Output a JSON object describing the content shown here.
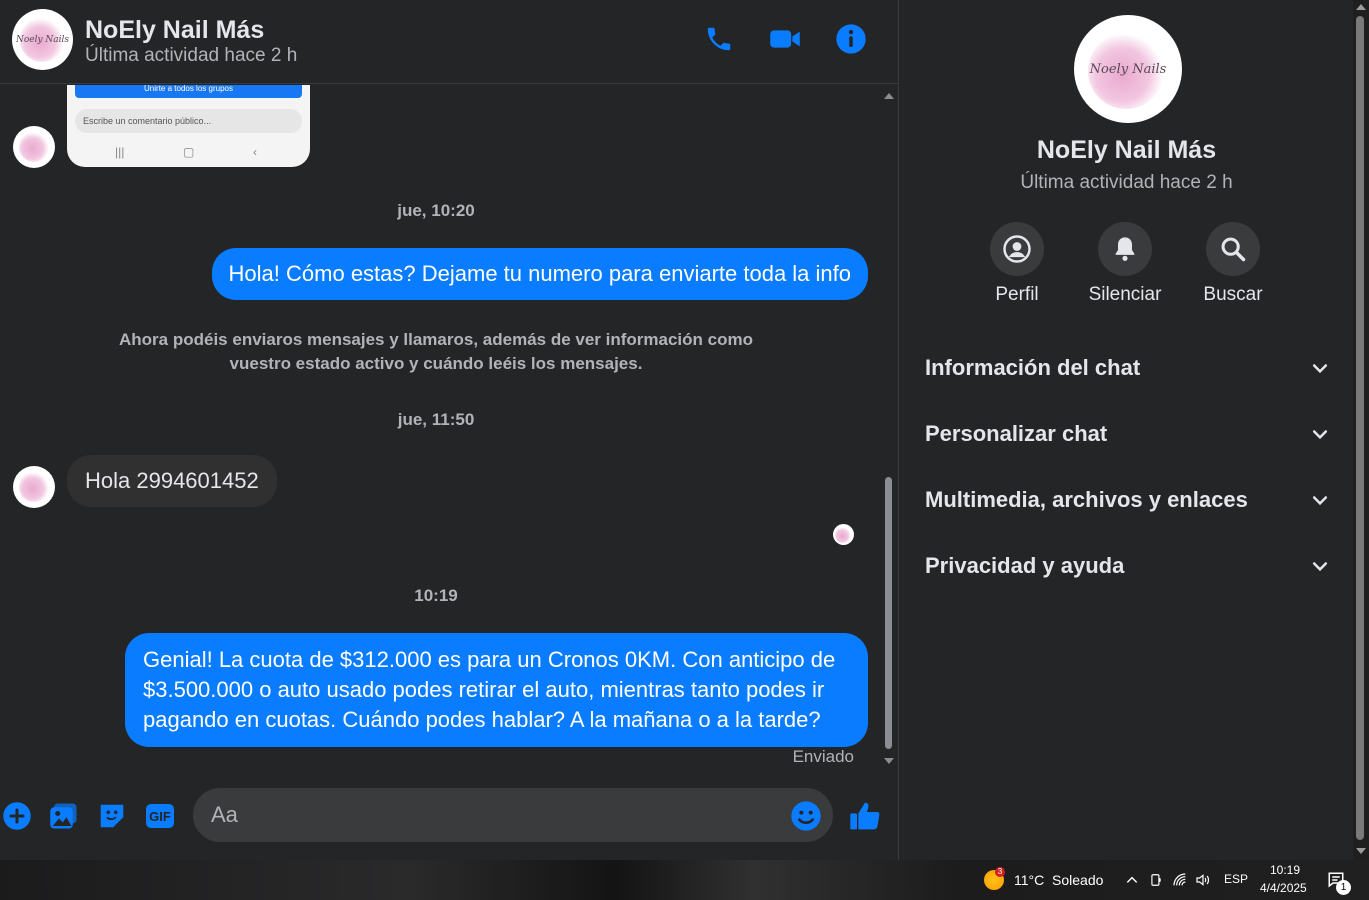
{
  "contact": {
    "name": "NoEly Nail Más",
    "status": "Última actividad hace 2 h",
    "logo_text": "Noely Nails"
  },
  "header_icons": [
    "phone-icon",
    "video-camera-icon",
    "info-icon"
  ],
  "shared_post": {
    "join_label": "Unirte a todos los grupos",
    "comment_placeholder": "Escribe un comentario público..."
  },
  "messages": {
    "ts1": "jue, 10:20",
    "msg1": "Hola! Cómo estas? Dejame tu numero para enviarte toda la info",
    "system_note": "Ahora podéis enviaros mensajes y llamaros, además de ver información como vuestro estado activo y cuándo leéis los mensajes.",
    "ts2": "jue, 11:50",
    "msg2": "Hola 2994601452",
    "ts3": "10:19",
    "msg3": "Genial! La cuota de $312.000 es para un Cronos 0KM. Con anticipo de $3.500.000 o auto usado podes retirar el auto, mientras tanto podes ir pagando en cuotas. Cuándo podes hablar? A la mañana o a la tarde?",
    "sent_status": "Enviado"
  },
  "composer": {
    "placeholder": "Aa",
    "gif_label": "GIF"
  },
  "panel": {
    "actions": [
      {
        "label": "Perfil",
        "icon": "profile-icon"
      },
      {
        "label": "Silenciar",
        "icon": "bell-icon"
      },
      {
        "label": "Buscar",
        "icon": "search-icon"
      }
    ],
    "sections": [
      {
        "title": "Información del chat"
      },
      {
        "title": "Personalizar chat"
      },
      {
        "title": "Multimedia, archivos y enlaces"
      },
      {
        "title": "Privacidad y ayuda"
      }
    ]
  },
  "taskbar": {
    "weather_badge": "3",
    "weather": "11°C  Soleado",
    "language": "ESP",
    "time": "10:19",
    "date": "4/4/2025",
    "notification_count": "1"
  },
  "colors": {
    "accent": "#0a7cff",
    "background": "#242526",
    "incoming_bubble": "#303030"
  }
}
